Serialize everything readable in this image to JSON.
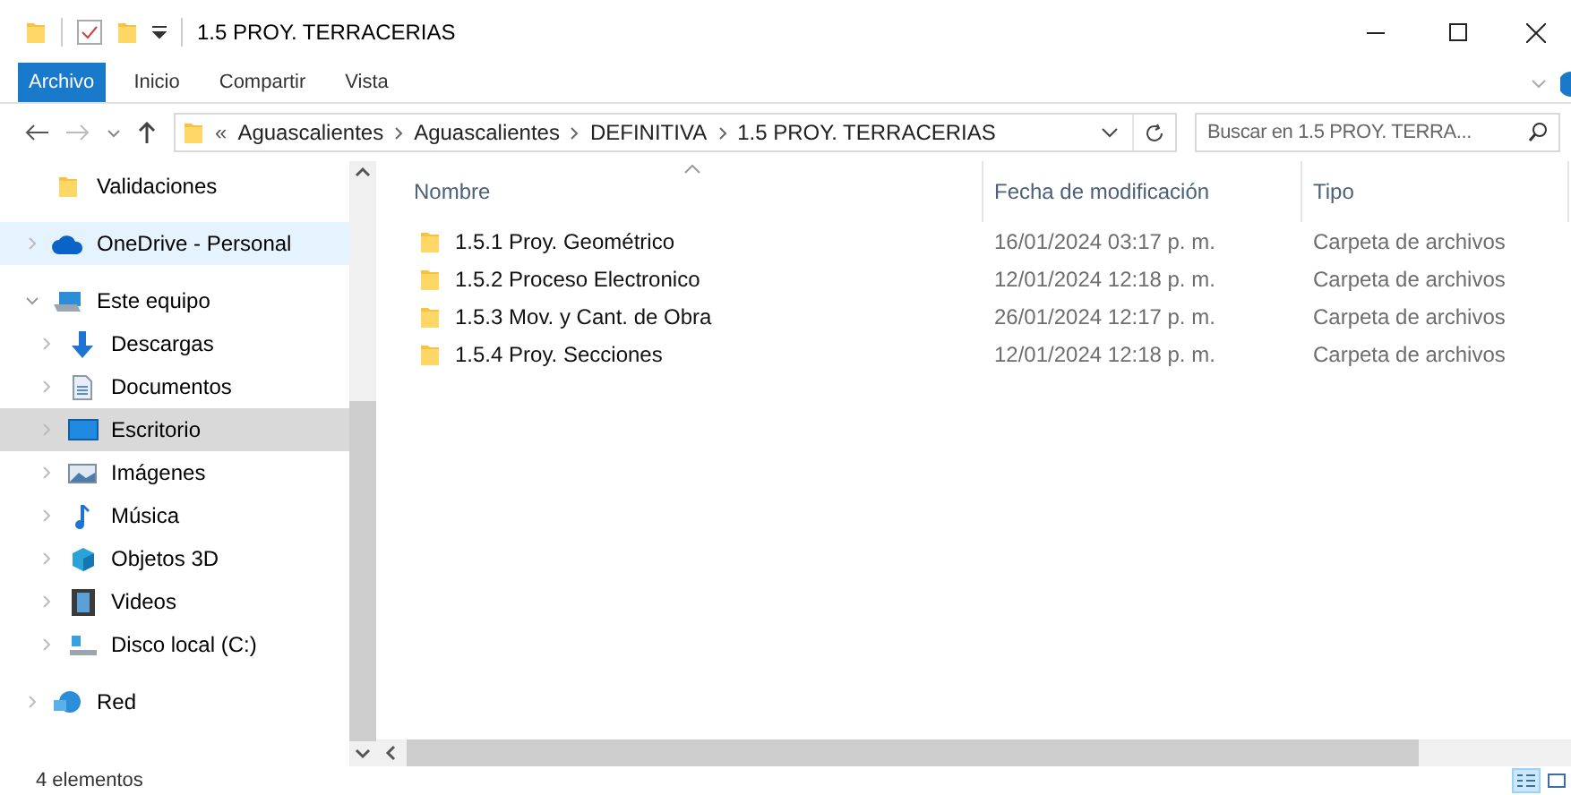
{
  "window": {
    "title": "1.5 PROY. TERRACERIAS"
  },
  "ribbon_tabs": [
    {
      "label": "Archivo",
      "selected": true
    },
    {
      "label": "Inicio",
      "selected": false
    },
    {
      "label": "Compartir",
      "selected": false
    },
    {
      "label": "Vista",
      "selected": false
    }
  ],
  "address": {
    "overflow": "«",
    "path": [
      "Aguascalientes",
      "Aguascalientes",
      "DEFINITIVA",
      "1.5 PROY. TERRACERIAS"
    ]
  },
  "search": {
    "placeholder": "Buscar en 1.5 PROY. TERRA..."
  },
  "sidebar": {
    "items": [
      {
        "label": "Validaciones",
        "kind": "folder",
        "expandable": false,
        "expanded": false,
        "selected": false,
        "hovered": false
      },
      {
        "label": "OneDrive - Personal",
        "kind": "cloud",
        "expandable": true,
        "expanded": false,
        "selected": false,
        "hovered": true
      },
      {
        "label": "Este equipo",
        "kind": "pc",
        "expandable": true,
        "expanded": true,
        "selected": false,
        "hovered": false,
        "children": [
          {
            "label": "Descargas",
            "kind": "download",
            "expandable": true,
            "expanded": false,
            "selected": false,
            "hovered": false
          },
          {
            "label": "Documentos",
            "kind": "document",
            "expandable": true,
            "expanded": false,
            "selected": false,
            "hovered": false
          },
          {
            "label": "Escritorio",
            "kind": "desktop",
            "expandable": true,
            "expanded": false,
            "selected": true,
            "hovered": false
          },
          {
            "label": "Imágenes",
            "kind": "pictures",
            "expandable": true,
            "expanded": false,
            "selected": false,
            "hovered": false
          },
          {
            "label": "Música",
            "kind": "music",
            "expandable": true,
            "expanded": false,
            "selected": false,
            "hovered": false
          },
          {
            "label": "Objetos 3D",
            "kind": "cube",
            "expandable": true,
            "expanded": false,
            "selected": false,
            "hovered": false
          },
          {
            "label": "Videos",
            "kind": "video",
            "expandable": true,
            "expanded": false,
            "selected": false,
            "hovered": false
          },
          {
            "label": "Disco local (C:)",
            "kind": "drive",
            "expandable": true,
            "expanded": false,
            "selected": false,
            "hovered": false
          }
        ]
      },
      {
        "label": "Red",
        "kind": "network",
        "expandable": true,
        "expanded": false,
        "selected": false,
        "hovered": false
      }
    ]
  },
  "table": {
    "columns": [
      "Nombre",
      "Fecha de modificación",
      "Tipo"
    ],
    "rows": [
      {
        "name": "1.5.1 Proy. Geométrico",
        "date": "16/01/2024 03:17 p. m.",
        "type": "Carpeta de archivos"
      },
      {
        "name": "1.5.2 Proceso Electronico",
        "date": "12/01/2024 12:18 p. m.",
        "type": "Carpeta de archivos"
      },
      {
        "name": "1.5.3 Mov. y Cant. de Obra",
        "date": "26/01/2024 12:17 p. m.",
        "type": "Carpeta de archivos"
      },
      {
        "name": "1.5.4 Proy. Secciones",
        "date": "12/01/2024 12:18 p. m.",
        "type": "Carpeta de archivos"
      }
    ]
  },
  "status_bar": {
    "count": "4 elementos",
    "views": [
      {
        "kind": "details",
        "selected": true
      },
      {
        "kind": "tiles",
        "selected": false
      }
    ]
  }
}
